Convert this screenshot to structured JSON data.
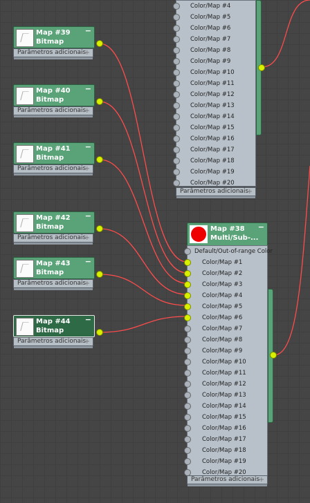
{
  "bitmap_nodes": [
    {
      "title": "Map #39",
      "type": "Bitmap",
      "params": "Parâmetros adicionais",
      "selected": false
    },
    {
      "title": "Map #40",
      "type": "Bitmap",
      "params": "Parâmetros adicionais",
      "selected": false
    },
    {
      "title": "Map #41",
      "type": "Bitmap",
      "params": "Parâmetros adicionais",
      "selected": false
    },
    {
      "title": "Map #42",
      "type": "Bitmap",
      "params": "Parâmetros adicionais",
      "selected": false
    },
    {
      "title": "Map #43",
      "type": "Bitmap",
      "params": "Parâmetros adicionais",
      "selected": false
    },
    {
      "title": "Map #44",
      "type": "Bitmap",
      "params": "Parâmetros adicionais",
      "selected": true
    }
  ],
  "top_node": {
    "rows": [
      "Color/Map #4",
      "Color/Map #5",
      "Color/Map #6",
      "Color/Map #7",
      "Color/Map #8",
      "Color/Map #9",
      "Color/Map #10",
      "Color/Map #11",
      "Color/Map #12",
      "Color/Map #13",
      "Color/Map #14",
      "Color/Map #15",
      "Color/Map #16",
      "Color/Map #17",
      "Color/Map #18",
      "Color/Map #19",
      "Color/Map #20"
    ],
    "params": "Parâmetros adicionais"
  },
  "main_node": {
    "title": "Map #38",
    "type": "Multi/Sub-...",
    "first_row": "Default/Out-of-range Color",
    "rows": [
      "Color/Map #1",
      "Color/Map #2",
      "Color/Map #3",
      "Color/Map #4",
      "Color/Map #5",
      "Color/Map #6",
      "Color/Map #7",
      "Color/Map #8",
      "Color/Map #9",
      "Color/Map #10",
      "Color/Map #11",
      "Color/Map #12",
      "Color/Map #13",
      "Color/Map #14",
      "Color/Map #15",
      "Color/Map #16",
      "Color/Map #17",
      "Color/Map #18",
      "Color/Map #19",
      "Color/Map #20"
    ],
    "connected_rows": 6,
    "params": "Parâmetros adicionais"
  },
  "icons": {
    "collapse": "minus-icon",
    "expand": "plus-icon",
    "swatch": "red-color-swatch"
  },
  "colors": {
    "wire": "#ff4c4c",
    "socket_active": "#d8f000",
    "node_header": "#5aa378",
    "node_header_selected": "#2f6a47",
    "node_body": "#b8c1c9"
  },
  "symbols": {
    "minus": "−",
    "plus": "+"
  }
}
